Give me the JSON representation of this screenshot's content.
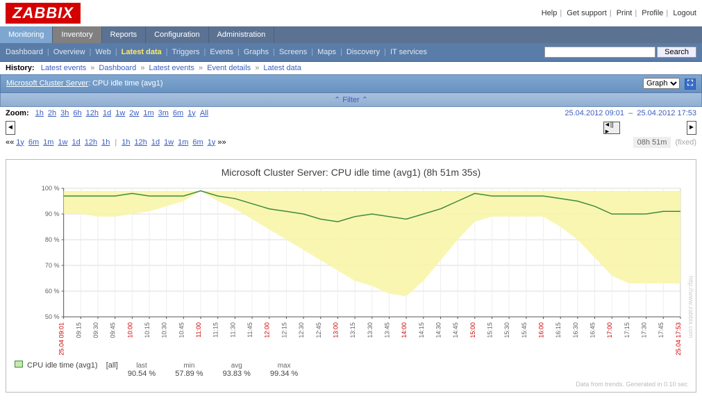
{
  "logo": "ZABBIX",
  "top_links": [
    "Help",
    "Get support",
    "Print",
    "Profile",
    "Logout"
  ],
  "main_nav": [
    "Monitoring",
    "Inventory",
    "Reports",
    "Configuration",
    "Administration"
  ],
  "sub_nav": [
    "Dashboard",
    "Overview",
    "Web",
    "Latest data",
    "Triggers",
    "Events",
    "Graphs",
    "Screens",
    "Maps",
    "Discovery",
    "IT services"
  ],
  "sub_nav_active": "Latest data",
  "search_btn": "Search",
  "history": {
    "label": "History:",
    "items": [
      "Latest events",
      "Dashboard",
      "Latest events",
      "Event details",
      "Latest data"
    ]
  },
  "title": {
    "host": "Microsoft Cluster Server",
    "item": ": CPU idle time (avg1)"
  },
  "view_select": "Graph",
  "filter_label": "Filter",
  "zoom": {
    "label": "Zoom:",
    "opts": [
      "1h",
      "2h",
      "3h",
      "6h",
      "12h",
      "1d",
      "1w",
      "2w",
      "1m",
      "3m",
      "6m",
      "1y",
      "All"
    ],
    "from": "25.04.2012 09:01",
    "to": "25.04.2012 17:53"
  },
  "time_nav": {
    "left": [
      "1y",
      "6m",
      "1m",
      "1w",
      "1d",
      "12h",
      "1h"
    ],
    "right": [
      "1h",
      "12h",
      "1d",
      "1w",
      "1m",
      "6m",
      "1y"
    ],
    "duration": "08h 51m",
    "fixed": "(fixed)"
  },
  "chart_data": {
    "type": "line",
    "title": "Microsoft Cluster Server: CPU idle time (avg1) (8h 51m 35s)",
    "ylabel": "",
    "ylim": [
      50,
      100
    ],
    "yticks": [
      "50 %",
      "60 %",
      "70 %",
      "80 %",
      "90 %",
      "100 %"
    ],
    "xticks": [
      {
        "l": "25.04 09:01",
        "red": true
      },
      {
        "l": "09:15"
      },
      {
        "l": "09:30"
      },
      {
        "l": "09:45"
      },
      {
        "l": "10:00",
        "red": true
      },
      {
        "l": "10:15"
      },
      {
        "l": "10:30"
      },
      {
        "l": "10:45"
      },
      {
        "l": "11:00",
        "red": true
      },
      {
        "l": "11:15"
      },
      {
        "l": "11:30"
      },
      {
        "l": "11:45"
      },
      {
        "l": "12:00",
        "red": true
      },
      {
        "l": "12:15"
      },
      {
        "l": "12:30"
      },
      {
        "l": "12:45"
      },
      {
        "l": "13:00",
        "red": true
      },
      {
        "l": "13:15"
      },
      {
        "l": "13:30"
      },
      {
        "l": "13:45"
      },
      {
        "l": "14:00",
        "red": true
      },
      {
        "l": "14:15"
      },
      {
        "l": "14:30"
      },
      {
        "l": "14:45"
      },
      {
        "l": "15:00",
        "red": true
      },
      {
        "l": "15:15"
      },
      {
        "l": "15:30"
      },
      {
        "l": "15:45"
      },
      {
        "l": "16:00",
        "red": true
      },
      {
        "l": "16:15"
      },
      {
        "l": "16:30"
      },
      {
        "l": "16:45"
      },
      {
        "l": "17:00",
        "red": true
      },
      {
        "l": "17:15"
      },
      {
        "l": "17:30"
      },
      {
        "l": "17:45"
      },
      {
        "l": "25.04 17:53",
        "red": true
      }
    ],
    "series": [
      {
        "name": "CPU idle time (avg1)",
        "color": "#3d8b3d",
        "avg": [
          97,
          97,
          97,
          97,
          98,
          97,
          97,
          97,
          99,
          97,
          96,
          94,
          92,
          91,
          90,
          88,
          87,
          89,
          90,
          89,
          88,
          90,
          92,
          95,
          98,
          97,
          97,
          97,
          97,
          96,
          95,
          93,
          90,
          90,
          90,
          91,
          91
        ],
        "upper": [
          99,
          99,
          99,
          99,
          99,
          99,
          99,
          99,
          99,
          99,
          99,
          99,
          99,
          99,
          99,
          99,
          99,
          99,
          99,
          99,
          99,
          99,
          99,
          99,
          99,
          99,
          99,
          99,
          99,
          99,
          99,
          99,
          99,
          99,
          99,
          99,
          99
        ],
        "lower": [
          90,
          90,
          89,
          89,
          90,
          91,
          93,
          95,
          99,
          95,
          92,
          88,
          84,
          80,
          76,
          72,
          68,
          64,
          62,
          59,
          58,
          64,
          72,
          80,
          87,
          89,
          89,
          89,
          89,
          85,
          80,
          73,
          66,
          63,
          63,
          63,
          63
        ]
      }
    ],
    "legend_stats": {
      "all": "[all]",
      "last": "90.54 %",
      "min": "57.89 %",
      "avg": "93.83 %",
      "max": "99.34 %"
    }
  },
  "footer": "Data from trends. Generated in 0.10 sec",
  "watermark": "http://www.zabbix.com"
}
